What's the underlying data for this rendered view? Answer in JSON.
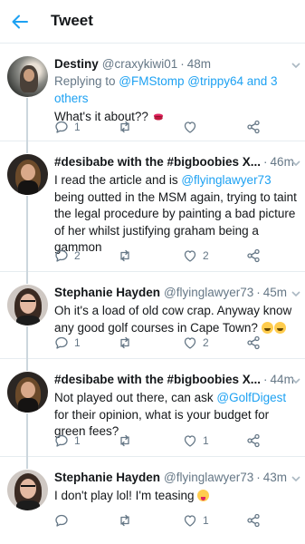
{
  "header": {
    "title": "Tweet",
    "back_icon": "arrow-left-icon"
  },
  "tweets": [
    {
      "name": "Destiny",
      "handle": "@craxykiwi01",
      "time": "48m",
      "replying_prefix": "Replying to ",
      "replying_to": "@FMStomp @trippy64 and 3 others",
      "text": "What's it about??",
      "emoji": "kiss-lips-emoji",
      "reply_count": "1",
      "retweet_count": "",
      "like_count": ""
    },
    {
      "name": "#desibabe with the #bigboobies X...",
      "handle": "",
      "time": "46m",
      "text_before": "I read the article and is ",
      "mention": "@flyinglawyer73",
      "text_after": " being outted in the MSM again, trying to taint the legal procedure by painting a bad picture of her whilst justifying graham being a gammon",
      "reply_count": "2",
      "retweet_count": "",
      "like_count": "2"
    },
    {
      "name": "Stephanie Hayden",
      "handle": "@flyinglawyer73",
      "time": "45m",
      "text": "Oh it's a load of old cow crap. Anyway know any good golf courses in Cape Town?",
      "emoji": "laughing-emoji",
      "reply_count": "1",
      "retweet_count": "",
      "like_count": "2"
    },
    {
      "name": "#desibabe with the #bigboobies X...",
      "handle": "",
      "time": "44m",
      "text_before": "Not played out there, can ask ",
      "mention": "@GolfDigest",
      "text_after": " for their opinion, what is your budget for green fees?",
      "reply_count": "1",
      "retweet_count": "",
      "like_count": "1"
    },
    {
      "name": "Stephanie Hayden",
      "handle": "@flyinglawyer73",
      "time": "43m",
      "text": "I don't play lol! I'm teasing",
      "emoji": "tongue-wink-emoji",
      "reply_count": "",
      "retweet_count": "",
      "like_count": "1"
    }
  ],
  "colors": {
    "accent": "#1da1f2",
    "secondary_text": "#657786",
    "divider": "#e6ecf0"
  }
}
